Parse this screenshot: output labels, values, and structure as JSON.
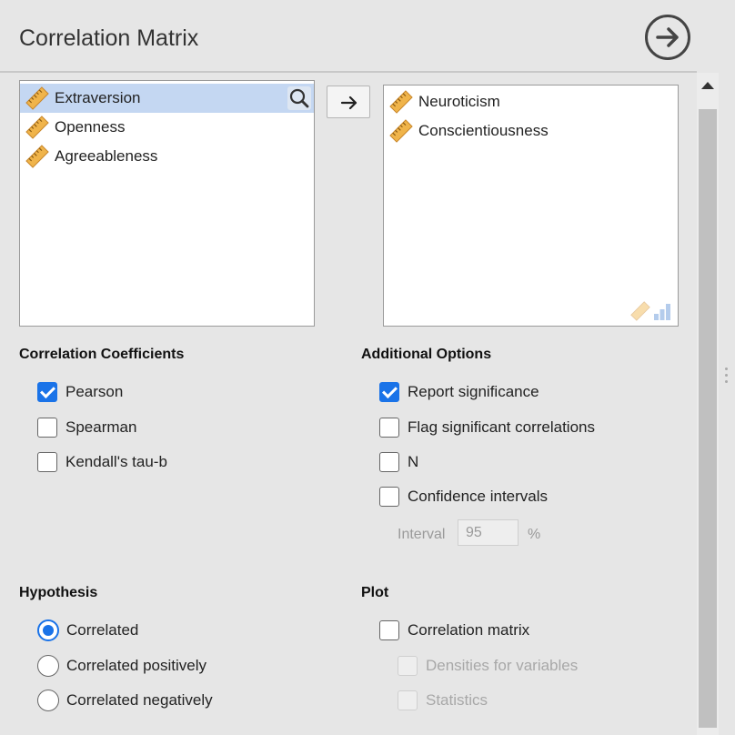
{
  "header": {
    "title": "Correlation Matrix"
  },
  "variables": {
    "available": [
      {
        "label": "Extraversion",
        "selected": true
      },
      {
        "label": "Openness",
        "selected": false
      },
      {
        "label": "Agreeableness",
        "selected": false
      }
    ],
    "assigned": [
      {
        "label": "Neuroticism"
      },
      {
        "label": "Conscientiousness"
      }
    ]
  },
  "coefficients": {
    "heading": "Correlation Coefficients",
    "options": [
      {
        "label": "Pearson",
        "checked": true
      },
      {
        "label": "Spearman",
        "checked": false
      },
      {
        "label": "Kendall's tau-b",
        "checked": false
      }
    ]
  },
  "additional": {
    "heading": "Additional Options",
    "options": [
      {
        "label": "Report significance",
        "checked": true
      },
      {
        "label": "Flag significant correlations",
        "checked": false
      },
      {
        "label": "N",
        "checked": false
      },
      {
        "label": "Confidence intervals",
        "checked": false
      }
    ],
    "interval_label": "Interval",
    "interval_value": "95",
    "interval_unit": "%"
  },
  "hypothesis": {
    "heading": "Hypothesis",
    "options": [
      {
        "label": "Correlated",
        "checked": true
      },
      {
        "label": "Correlated positively",
        "checked": false
      },
      {
        "label": "Correlated negatively",
        "checked": false
      }
    ]
  },
  "plot": {
    "heading": "Plot",
    "options": [
      {
        "label": "Correlation matrix",
        "checked": false,
        "disabled": false
      },
      {
        "label": "Densities for variables",
        "checked": false,
        "disabled": true
      },
      {
        "label": "Statistics",
        "checked": false,
        "disabled": true
      }
    ]
  },
  "colors": {
    "accent": "#1a73e8",
    "selection": "#c4d7f2",
    "ruler_icon": "#f0b44a",
    "background": "#e6e6e6"
  },
  "icons": {
    "variable": "ruler-icon",
    "search": "search-icon",
    "move": "arrow-right-icon",
    "run": "arrow-circle-right-icon"
  }
}
